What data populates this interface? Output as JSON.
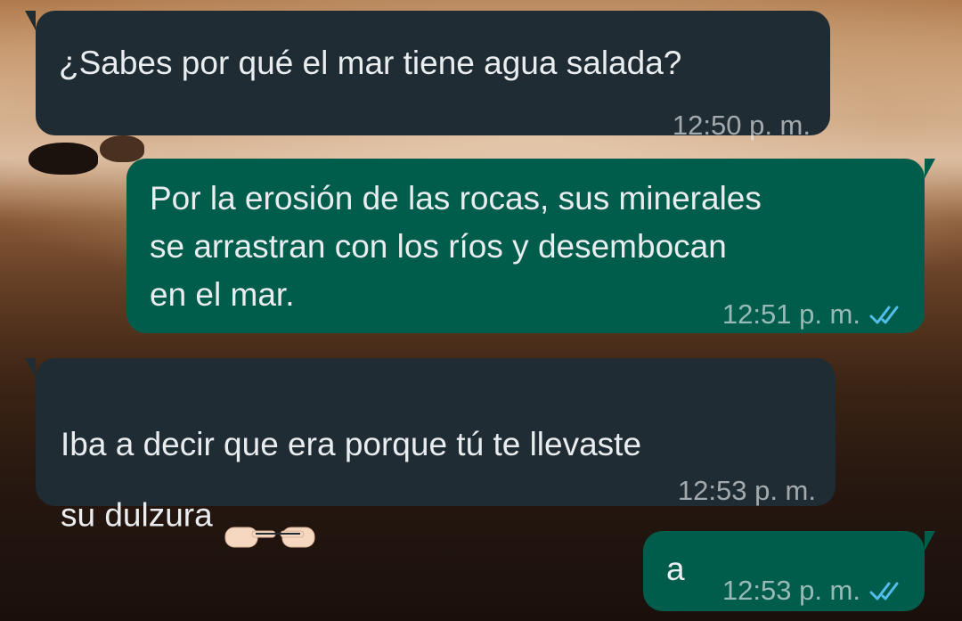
{
  "messages": [
    {
      "direction": "incoming",
      "text": "¿Sabes por qué el mar tiene agua salada?",
      "time": "12:50 p. m."
    },
    {
      "direction": "outgoing",
      "text": "Por la erosión de las rocas, sus minerales\nse arrastran con los ríos y desembocan\nen el mar.",
      "time": "12:51 p. m.",
      "status": "read"
    },
    {
      "direction": "incoming",
      "text": "Iba a decir que era porque tú te llevaste\nsu dulzura",
      "emoji": "👉👈",
      "time": "12:53 p. m."
    },
    {
      "direction": "outgoing",
      "text": "a",
      "time": "12:53 p. m.",
      "status": "read"
    }
  ],
  "colors": {
    "incoming_bubble": "#1f2c33",
    "outgoing_bubble": "#005c4b",
    "text": "#e9edef",
    "read_ticks": "#53bdeb"
  },
  "icons": {
    "read_receipt": "double-check-icon",
    "emoji": "pointing-fingers-emoji"
  }
}
